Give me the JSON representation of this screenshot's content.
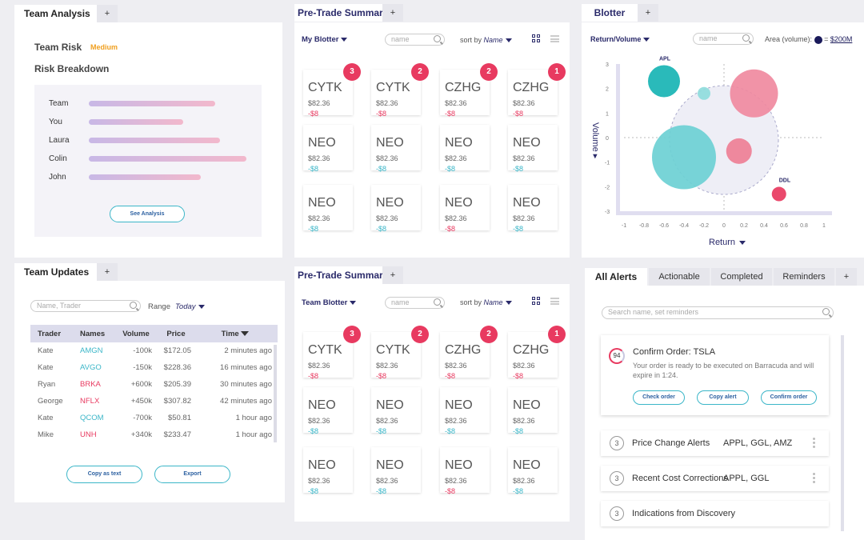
{
  "team_analysis": {
    "tab": "Team Analysis",
    "plus": "+",
    "risk_title": "Team Risk",
    "risk_level": "Medium",
    "breakdown_title": "Risk Breakdown",
    "members": [
      {
        "name": "Team",
        "value": 0.8
      },
      {
        "name": "You",
        "value": 0.6
      },
      {
        "name": "Laura",
        "value": 0.83
      },
      {
        "name": "Colin",
        "value": 1.0
      },
      {
        "name": "John",
        "value": 0.71
      }
    ],
    "see_analysis": "See Analysis"
  },
  "team_updates": {
    "tab": "Team Updates",
    "plus": "+",
    "search_placeholder": "Name, Trader",
    "range_label": "Range",
    "range_value": "Today",
    "columns": [
      "Trader",
      "Names",
      "Volume",
      "Price",
      "Time"
    ],
    "rows": [
      {
        "trader": "Kate",
        "name": "AMGN",
        "volume": "-100k",
        "price": "$172.05",
        "time": "2 minutes ago",
        "color": "#3bb6c8"
      },
      {
        "trader": "Kate",
        "name": "AVGO",
        "volume": "-150k",
        "price": "$228.36",
        "time": "16 minutes ago",
        "color": "#3bb6c8"
      },
      {
        "trader": "Ryan",
        "name": "BRKA",
        "volume": "+600k",
        "price": "$205.39",
        "time": "30 minutes ago",
        "color": "#e83a60"
      },
      {
        "trader": "George",
        "name": "NFLX",
        "volume": "+450k",
        "price": "$307.82",
        "time": "42 minutes ago",
        "color": "#e83a60"
      },
      {
        "trader": "Kate",
        "name": "QCOM",
        "volume": "-700k",
        "price": "$50.81",
        "time": "1 hour ago",
        "color": "#3bb6c8"
      },
      {
        "trader": "Mike",
        "name": "UNH",
        "volume": "+340k",
        "price": "$233.47",
        "time": "1 hour ago",
        "color": "#e83a60"
      }
    ],
    "copy_text": "Copy as text",
    "export": "Export"
  },
  "pre_trade_top": {
    "tab": "Pre-Trade Summary",
    "plus": "+",
    "blotter_select": "My Blotter",
    "search_placeholder": "name",
    "sort_label": "sort by",
    "sort_value": "Name"
  },
  "pre_trade_bottom": {
    "tab": "Pre-Trade Summary",
    "plus": "+",
    "blotter_select": "Team Blotter",
    "search_placeholder": "name",
    "sort_label": "sort by",
    "sort_value": "Name"
  },
  "cards": [
    {
      "sym": "CYTK",
      "price": "$82.36",
      "change": "-$8",
      "neg": true,
      "badge": "3"
    },
    {
      "sym": "CYTK",
      "price": "$82.36",
      "change": "-$8",
      "neg": true,
      "badge": "2"
    },
    {
      "sym": "CZHG",
      "price": "$82.36",
      "change": "-$8",
      "neg": true,
      "badge": "2"
    },
    {
      "sym": "CZHG",
      "price": "$82.36",
      "change": "-$8",
      "neg": true,
      "badge": "1"
    },
    {
      "sym": "NEO",
      "price": "$82.36",
      "change": "-$8",
      "neg": false,
      "badge": ""
    },
    {
      "sym": "NEO",
      "price": "$82.36",
      "change": "-$8",
      "neg": false,
      "badge": ""
    },
    {
      "sym": "NEO",
      "price": "$82.36",
      "change": "-$8",
      "neg": false,
      "badge": ""
    },
    {
      "sym": "NEO",
      "price": "$82.36",
      "change": "-$8",
      "neg": false,
      "badge": ""
    },
    {
      "sym": "NEO",
      "price": "$82.36",
      "change": "-$8",
      "neg": false,
      "badge": ""
    },
    {
      "sym": "NEO",
      "price": "$82.36",
      "change": "-$8",
      "neg": false,
      "badge": ""
    },
    {
      "sym": "NEO",
      "price": "$82.36",
      "change": "-$8",
      "neg": true,
      "badge": ""
    },
    {
      "sym": "NEO",
      "price": "$82.36",
      "change": "-$8",
      "neg": false,
      "badge": ""
    }
  ],
  "cards_bottom": [
    {
      "sym": "CYTK",
      "price": "$82.36",
      "change": "-$8",
      "neg": true,
      "badge": "3"
    },
    {
      "sym": "CYTK",
      "price": "$82.36",
      "change": "-$8",
      "neg": true,
      "badge": "2"
    },
    {
      "sym": "CZHG",
      "price": "$82.36",
      "change": "-$8",
      "neg": true,
      "badge": "2"
    },
    {
      "sym": "CZHG",
      "price": "$82.36",
      "change": "-$8",
      "neg": true,
      "badge": "1"
    },
    {
      "sym": "NEO",
      "price": "$82.36",
      "change": "-$8",
      "neg": false,
      "badge": ""
    },
    {
      "sym": "NEO",
      "price": "$82.36",
      "change": "-$8",
      "neg": false,
      "badge": ""
    },
    {
      "sym": "NEO",
      "price": "$82.36",
      "change": "-$8",
      "neg": false,
      "badge": ""
    },
    {
      "sym": "NEO",
      "price": "$82.36",
      "change": "-$8",
      "neg": false,
      "badge": ""
    },
    {
      "sym": "NEO",
      "price": "$82.36",
      "change": "-$8",
      "neg": false,
      "badge": ""
    },
    {
      "sym": "NEO",
      "price": "$82.36",
      "change": "-$8",
      "neg": false,
      "badge": ""
    },
    {
      "sym": "NEO",
      "price": "$82.36",
      "change": "-$8",
      "neg": true,
      "badge": ""
    },
    {
      "sym": "NEO",
      "price": "$82.36",
      "change": "-$8",
      "neg": false,
      "badge": ""
    }
  ],
  "blotter": {
    "tab": "Blotter",
    "plus": "+",
    "mode": "Return/Volume",
    "search_placeholder": "name",
    "area_label": "Area (volume):",
    "area_eq": "=",
    "area_value": "$200M",
    "y_label": "Volume",
    "x_label": "Return",
    "chart_data": {
      "type": "scatter",
      "x_ticks": [
        "-1",
        "-0.8",
        "-0.6",
        "-0.4",
        "-0.2",
        "0",
        "0.2",
        "0.4",
        "0.6",
        "0.8",
        "1"
      ],
      "y_ticks": [
        "3",
        "2",
        "1",
        "0",
        "-1",
        "-2",
        "-3"
      ],
      "xlim": [
        -1,
        1
      ],
      "ylim": [
        -3,
        3
      ],
      "points": [
        {
          "label": "APL",
          "x": -0.6,
          "y": 2.3,
          "r": 20,
          "color": "#18b4b4"
        },
        {
          "label": "",
          "x": -0.2,
          "y": 1.8,
          "r": 8,
          "color": "#8fdcdc"
        },
        {
          "label": "",
          "x": 0.3,
          "y": 1.8,
          "r": 30,
          "color": "#f08aa0"
        },
        {
          "label": "",
          "x": -0.4,
          "y": -0.8,
          "r": 40,
          "color": "#6dd0d4"
        },
        {
          "label": "",
          "x": 0.15,
          "y": -0.55,
          "r": 16,
          "color": "#ee7f95"
        },
        {
          "label": "DDL",
          "x": 0.55,
          "y": -2.3,
          "r": 9,
          "color": "#e83a60"
        }
      ]
    }
  },
  "alerts": {
    "tabs": [
      "All Alerts",
      "Actionable",
      "Completed",
      "Reminders"
    ],
    "plus": "+",
    "search_placeholder": "Search name, set reminders",
    "confirm": {
      "score": "94",
      "title": "Confirm Order: TSLA",
      "body": "Your order is ready to be executed on Barracuda and will expire in 1:24.",
      "btn_check": "Check order",
      "btn_copy": "Copy alert",
      "btn_confirm": "Confirm order"
    },
    "rows": [
      {
        "count": "3",
        "title": "Price Change Alerts",
        "detail": "APPL, GGL, AMZ"
      },
      {
        "count": "3",
        "title": "Recent Cost Corrections",
        "detail": "APPL, GGL"
      },
      {
        "count": "3",
        "title": "Indications from Discovery",
        "detail": ""
      }
    ]
  }
}
